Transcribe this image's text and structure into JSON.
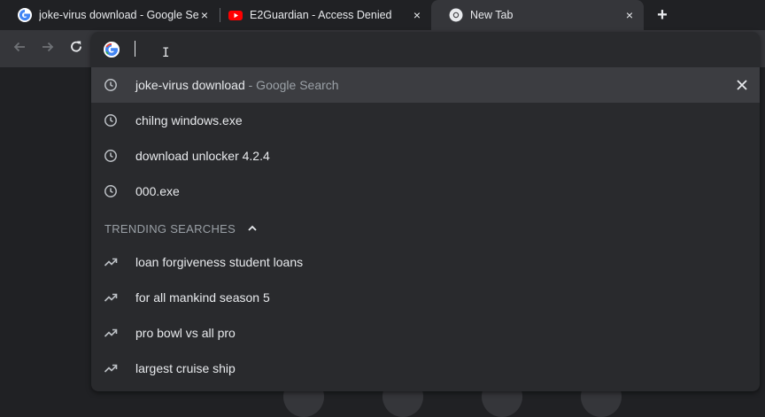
{
  "tabs": [
    {
      "title": "joke-virus download - Google Search",
      "favicon": "google-g-icon",
      "close": "×"
    },
    {
      "title": "E2Guardian - Access Denied",
      "favicon": "youtube-icon",
      "close": "×"
    },
    {
      "title": "New Tab",
      "favicon": "chrome-icon",
      "close": "×",
      "active": true
    }
  ],
  "new_tab_label": "+",
  "omnibox": {
    "value": "",
    "history": [
      {
        "query": "joke-virus download",
        "suffix": " - Google Search",
        "icon": "history-clock-icon"
      },
      {
        "query": "chilng windows.exe",
        "icon": "history-clock-icon"
      },
      {
        "query": "download unlocker 4.2.4",
        "icon": "history-clock-icon"
      },
      {
        "query": "000.exe",
        "icon": "history-clock-icon"
      }
    ],
    "trending_header": "TRENDING SEARCHES",
    "trending": [
      {
        "query": "loan forgiveness student loans",
        "icon": "trending-arrow-icon"
      },
      {
        "query": "for all mankind season 5",
        "icon": "trending-arrow-icon"
      },
      {
        "query": "pro bowl vs all pro",
        "icon": "trending-arrow-icon"
      },
      {
        "query": "largest cruise ship",
        "icon": "trending-arrow-icon"
      }
    ]
  },
  "colors": {
    "background": "#202124",
    "toolbar": "#35363a",
    "popup": "#292a2d",
    "selected_row": "#3c3d41",
    "text": "#e8eaed",
    "dim_text": "#9aa0a6"
  }
}
